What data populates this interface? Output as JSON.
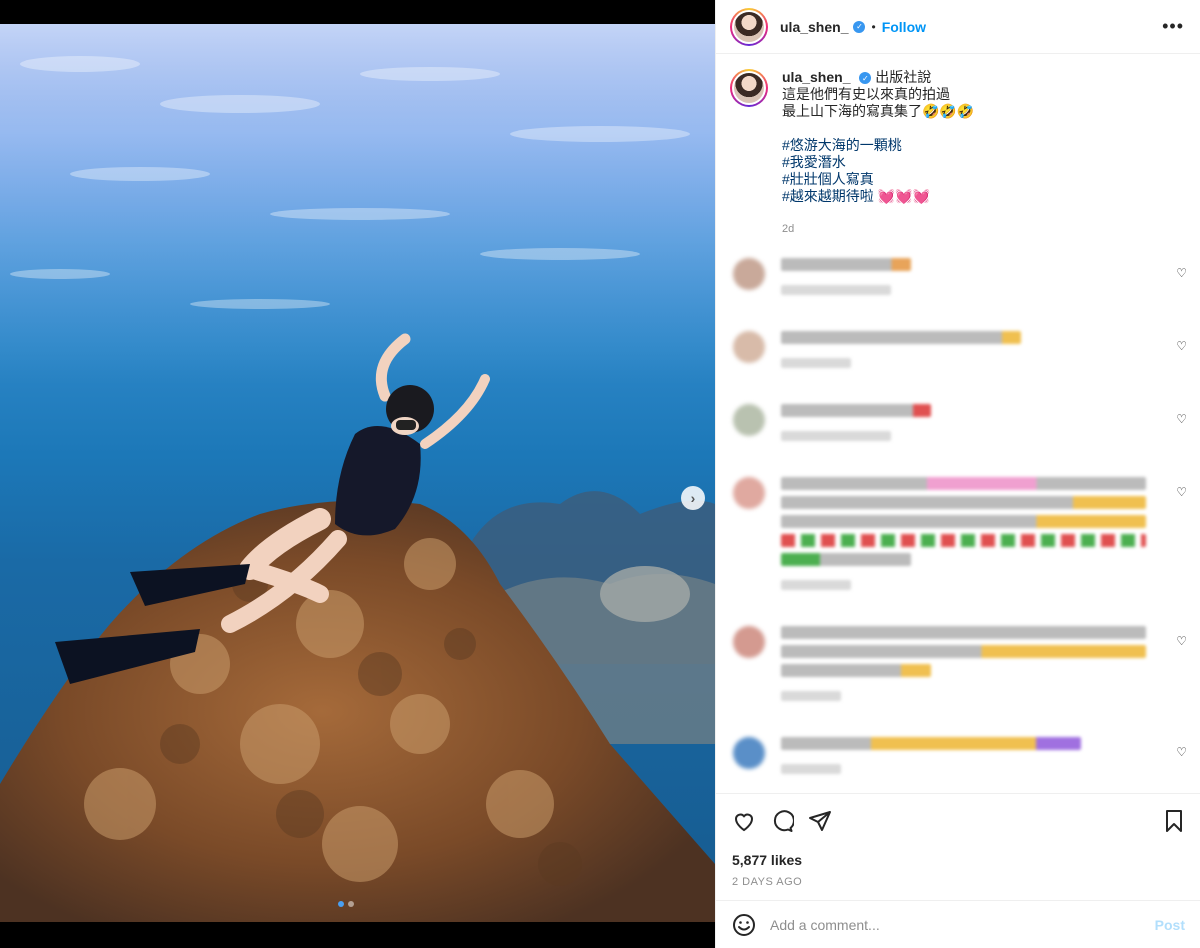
{
  "post": {
    "username": "ula_shen_",
    "follow_label": "Follow",
    "separator": "•",
    "more_glyph": "•••",
    "caption": {
      "username": "ula_shen_",
      "tag": "出版社說",
      "lines": [
        "這是他們有史以來真的拍過",
        "最上山下海的寫真集了🤣🤣🤣"
      ],
      "hashtags": [
        "#悠游大海的一顆桃",
        "#我愛潛水",
        "#壯壯個人寫真",
        "#越來越期待啦 💓💓💓"
      ],
      "age": "2d"
    },
    "likes": "5,877 likes",
    "time_ago": "2 DAYS AGO",
    "comment_placeholder": "Add a comment...",
    "post_label": "Post",
    "next_glyph": "›"
  },
  "colors": {
    "accent": "#0095f6",
    "hashtag": "#00376b",
    "muted": "#8e8e8e",
    "post_disabled": "#b2dffc"
  },
  "icons": [
    "verified-badge-icon",
    "more-icon",
    "heart-icon",
    "comment-icon",
    "share-icon",
    "bookmark-icon",
    "emoji-icon",
    "next-arrow-icon"
  ],
  "carousel": {
    "slides": 2,
    "active": 1
  }
}
